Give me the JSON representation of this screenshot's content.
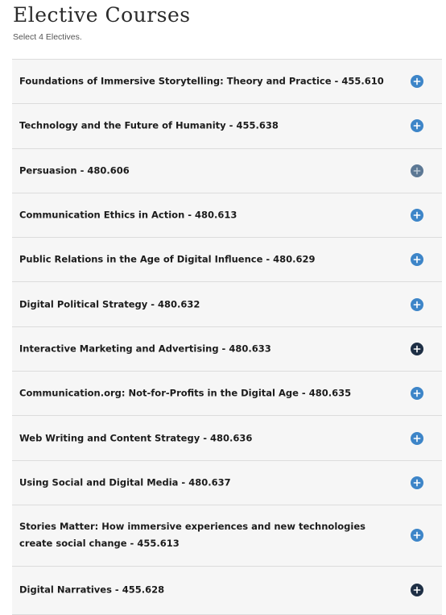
{
  "header": {
    "title": "Elective Courses",
    "subtitle": "Select 4 Electives."
  },
  "courses": [
    {
      "label": "Foundations of Immersive Storytelling: Theory and Practice - 455.610",
      "icon": "plus-icon",
      "icon_color": "#3d85c8"
    },
    {
      "label": "Technology and the Future of Humanity - 455.638",
      "icon": "plus-icon",
      "icon_color": "#3d85c8"
    },
    {
      "label": "Persuasion - 480.606",
      "icon": "plus-icon",
      "icon_color": "#5c7894"
    },
    {
      "label": "Communication Ethics in Action - 480.613",
      "icon": "plus-icon",
      "icon_color": "#3d85c8"
    },
    {
      "label": "Public Relations in the Age of Digital Influence - 480.629",
      "icon": "plus-icon",
      "icon_color": "#3d85c8"
    },
    {
      "label": "Digital Political Strategy - 480.632",
      "icon": "plus-icon",
      "icon_color": "#3d85c8"
    },
    {
      "label": "Interactive Marketing and Advertising - 480.633",
      "icon": "plus-icon",
      "icon_color": "#1e2f45"
    },
    {
      "label": "Communication.org: Not-for-Profits in the Digital Age - 480.635",
      "icon": "plus-icon",
      "icon_color": "#3d85c8"
    },
    {
      "label": "Web Writing and Content Strategy - 480.636",
      "icon": "plus-icon",
      "icon_color": "#3d85c8"
    },
    {
      "label": "Using Social and Digital Media - 480.637",
      "icon": "plus-icon",
      "icon_color": "#3d85c8"
    },
    {
      "label": "Stories Matter: How immersive experiences and new technologies create social change - 455.613",
      "icon": "plus-icon",
      "icon_color": "#3d85c8"
    },
    {
      "label": "Digital Narratives - 455.628",
      "icon": "plus-icon",
      "icon_color": "#1e2f45"
    }
  ]
}
